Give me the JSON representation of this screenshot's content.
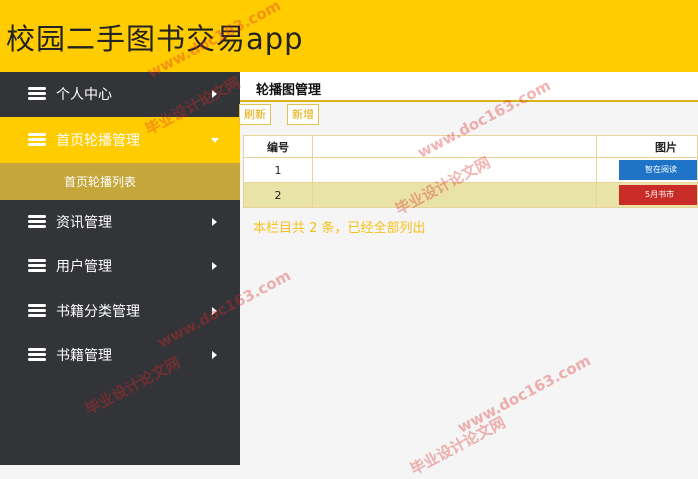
{
  "header": {
    "title": "校园二手图书交易app"
  },
  "sidebar": {
    "items": [
      {
        "label": "个人中心",
        "expanded": false
      },
      {
        "label": "首页轮播管理",
        "expanded": true,
        "children": [
          {
            "label": "首页轮播列表"
          }
        ]
      },
      {
        "label": "资讯管理",
        "expanded": false
      },
      {
        "label": "用户管理",
        "expanded": false
      },
      {
        "label": "书籍分类管理",
        "expanded": false
      },
      {
        "label": "书籍管理",
        "expanded": false
      }
    ]
  },
  "main": {
    "title": "轮播图管理",
    "toolbar": {
      "refresh_label": "刷新",
      "add_label": "新增"
    },
    "table": {
      "headers": [
        "编号",
        "",
        "图片"
      ],
      "rows": [
        {
          "id": "1",
          "thumb_text": "智在阅读"
        },
        {
          "id": "2",
          "thumb_text": "5月书市"
        }
      ]
    },
    "footer": "本栏目共 2 条，已经全部列出"
  },
  "watermark": {
    "line1": "毕业设计论文网",
    "line2": "www.doc163.com"
  },
  "colors": {
    "accent": "#ffcc00",
    "sidebar_bg": "#333438",
    "sub_bg": "#c5a63a",
    "alt_row": "#e9e3a8"
  }
}
